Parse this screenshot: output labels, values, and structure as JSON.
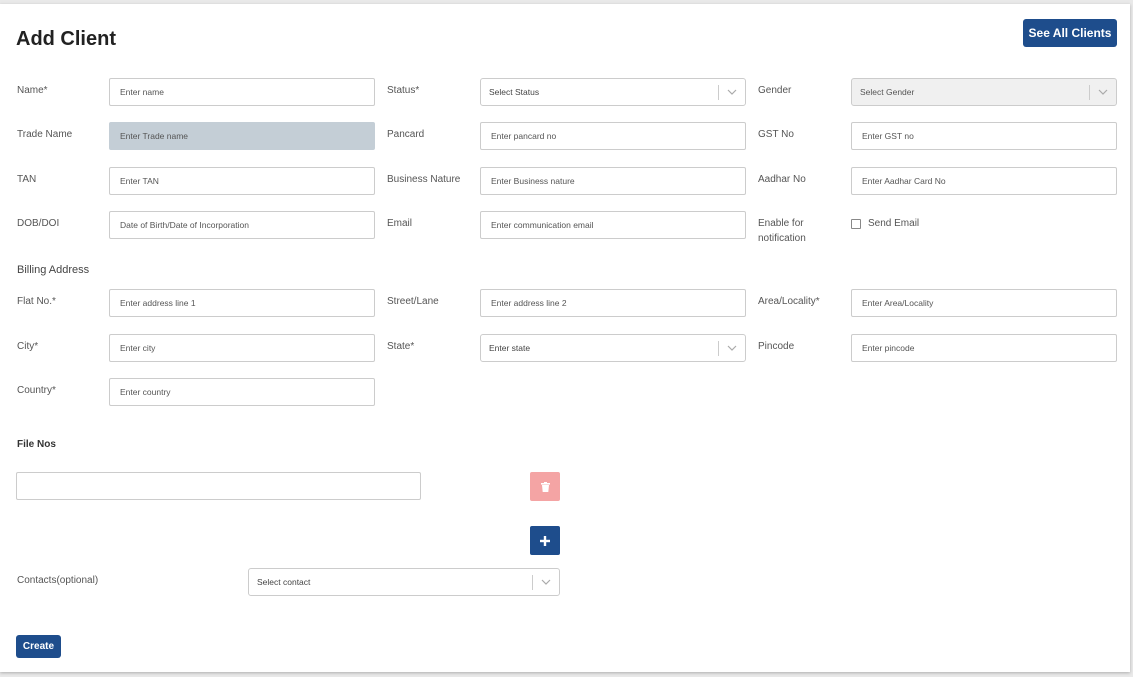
{
  "header": {
    "title": "Add Client",
    "see_all_label": "See All Clients"
  },
  "fields": {
    "name": {
      "label": "Name*",
      "placeholder": "Enter name"
    },
    "status": {
      "label": "Status*",
      "value": "Select Status"
    },
    "gender": {
      "label": "Gender",
      "value": "Select Gender"
    },
    "trade_name": {
      "label": "Trade Name",
      "placeholder": "Enter Trade name"
    },
    "pancard": {
      "label": "Pancard",
      "placeholder": "Enter pancard no"
    },
    "gst": {
      "label": "GST No",
      "placeholder": "Enter GST no"
    },
    "tan": {
      "label": "TAN",
      "placeholder": "Enter TAN"
    },
    "business_nature": {
      "label": "Business Nature",
      "placeholder": "Enter Business nature"
    },
    "aadhar": {
      "label": "Aadhar No",
      "placeholder": "Enter Aadhar Card No"
    },
    "dob": {
      "label": "DOB/DOI",
      "placeholder": "Date of Birth/Date of Incorporation"
    },
    "email": {
      "label": "Email",
      "placeholder": "Enter communication email"
    },
    "notification": {
      "label_line1": "Enable for",
      "label_line2": "notification",
      "checkbox_label": "Send Email"
    }
  },
  "billing": {
    "section_title": "Billing Address",
    "flat": {
      "label": "Flat No.*",
      "placeholder": "Enter address line 1"
    },
    "street": {
      "label": "Street/Lane",
      "placeholder": "Enter address line 2"
    },
    "area": {
      "label": "Area/Locality*",
      "placeholder": "Enter Area/Locality"
    },
    "city": {
      "label": "City*",
      "placeholder": "Enter city"
    },
    "state": {
      "label": "State*",
      "value": "Enter state"
    },
    "pincode": {
      "label": "Pincode",
      "placeholder": "Enter pincode"
    },
    "country": {
      "label": "Country*",
      "placeholder": "Enter country"
    }
  },
  "file_nos": {
    "section_title": "File Nos",
    "value": ""
  },
  "contacts": {
    "label": "Contacts(optional)",
    "value": "Select contact"
  },
  "actions": {
    "create_label": "Create"
  },
  "colors": {
    "primary": "#1e4d8c",
    "delete": "#f4a4a4",
    "disabled_input": "#c4ced6"
  }
}
